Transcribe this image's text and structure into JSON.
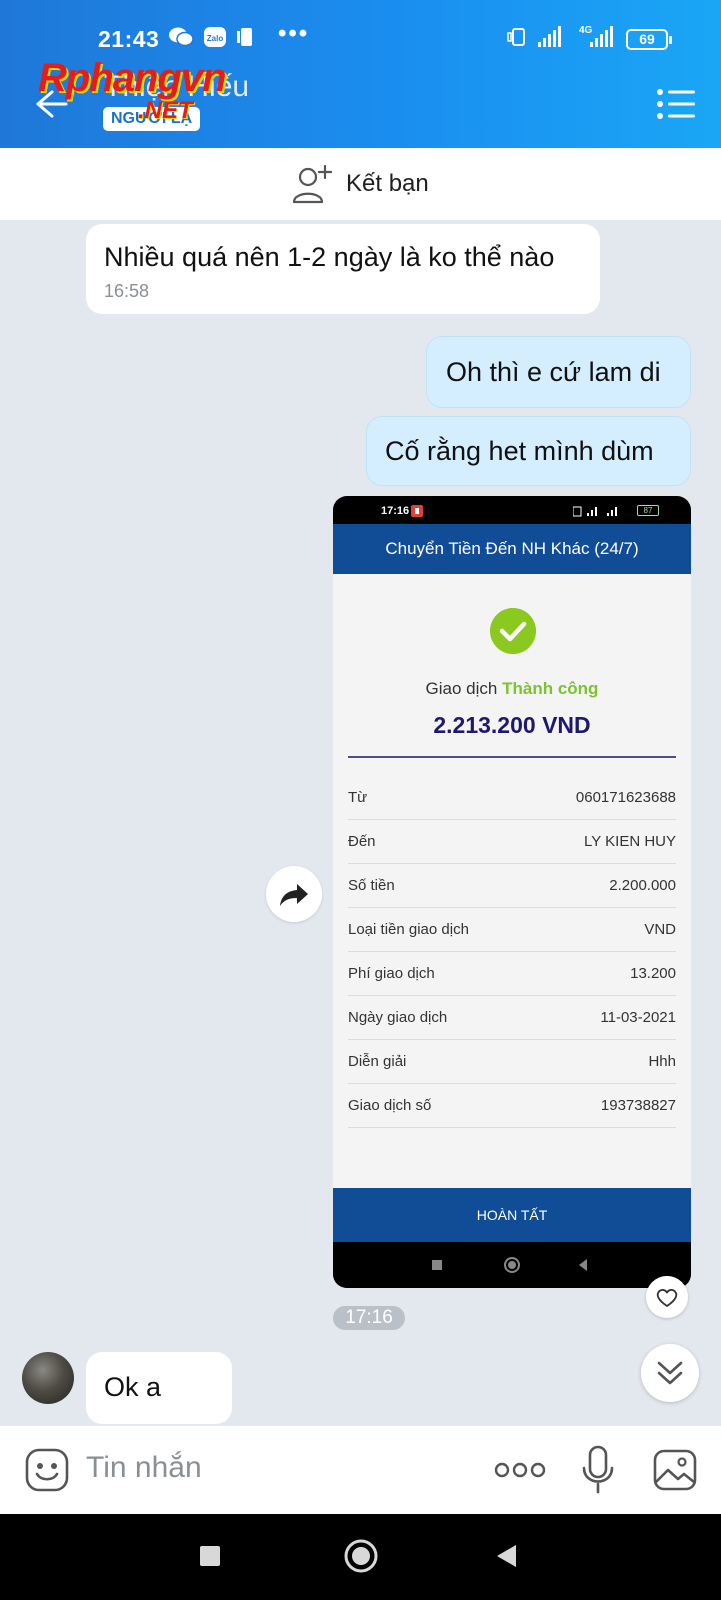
{
  "status_bar": {
    "time": "21:43",
    "network": "4G",
    "battery": "69"
  },
  "header": {
    "chat_name": "Thiện Hiếu",
    "stranger_tag": "NGƯỜI LẠ",
    "watermark_main": "Rphangvn",
    "watermark_sub": ".NET",
    "accent_color": "#1a8ef0"
  },
  "add_friend": {
    "label": "Kết bạn"
  },
  "messages": [
    {
      "direction": "incoming",
      "text": "Nhiều quá nên 1-2 ngày là ko thể nào",
      "time": "16:58"
    },
    {
      "direction": "outgoing",
      "text": "Oh thì e cứ lam di"
    },
    {
      "direction": "outgoing",
      "text": "Cố rằng het mình dùm"
    },
    {
      "direction": "incoming",
      "text": "Ok a"
    }
  ],
  "image_message": {
    "time": "17:16",
    "screenshot": {
      "status_time": "17:16",
      "battery": "87",
      "title": "Chuyển Tiền Đến NH Khác (24/7)",
      "status_prefix": "Giao dịch",
      "status_value": "Thành công",
      "amount": "2.213.200 VND",
      "rows": [
        {
          "label": "Từ",
          "value": "060171623688"
        },
        {
          "label": "Đến",
          "value": "LY KIEN HUY"
        },
        {
          "label": "Số tiền",
          "value": "2.200.000"
        },
        {
          "label": "Loại tiền giao dịch",
          "value": "VND"
        },
        {
          "label": "Phí giao dịch",
          "value": "13.200"
        },
        {
          "label": "Ngày giao dịch",
          "value": "11-03-2021"
        },
        {
          "label": "Diễn giải",
          "value": "Hhh"
        },
        {
          "label": "Giao dịch số",
          "value": "193738827"
        }
      ],
      "done_label": "HOÀN TẤT"
    }
  },
  "input": {
    "placeholder": "Tin nhắn"
  }
}
